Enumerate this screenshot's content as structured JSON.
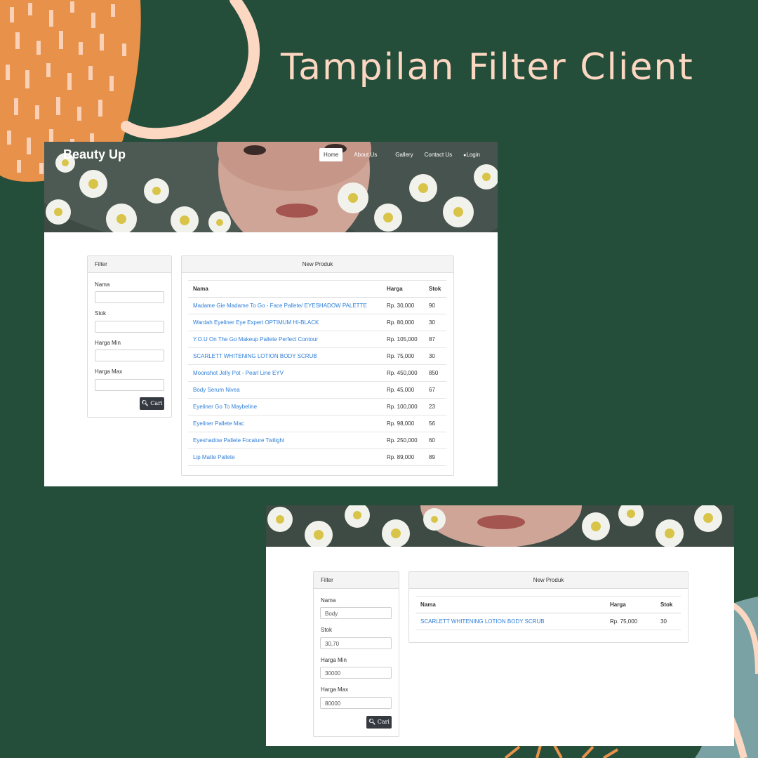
{
  "page": {
    "title": "Tampilan Filter Client"
  },
  "site": {
    "brand": "Beauty Up",
    "nav": [
      "Home",
      "About Us",
      "Gallery",
      "Contact Us",
      "Login"
    ]
  },
  "filter": {
    "header": "Filter",
    "labels": {
      "nama": "Nama",
      "stok": "Stok",
      "harga_min": "Harga Min",
      "harga_max": "Harga Max"
    },
    "button": "Cari"
  },
  "produk": {
    "header": "New Produk",
    "columns": [
      "Nama",
      "Harga",
      "Stok"
    ]
  },
  "screen1": {
    "inputs": {
      "nama": "",
      "stok": "",
      "harga_min": "",
      "harga_max": ""
    },
    "rows": [
      {
        "nama": "Madame Gie Madame To Go - Face Pallete/ EYESHADOW PALETTE",
        "harga": "Rp. 30,000",
        "stok": "90"
      },
      {
        "nama": "Wardah Eyeliner Eye Expert OPTIMUM HI-BLACK",
        "harga": "Rp. 80,000",
        "stok": "30"
      },
      {
        "nama": "Y.O.U On The Go Makeup Pallete Perfect Contour",
        "harga": "Rp. 105,000",
        "stok": "87"
      },
      {
        "nama": "SCARLETT WHITENING LOTION BODY SCRUB",
        "harga": "Rp. 75,000",
        "stok": "30"
      },
      {
        "nama": "Moonshot Jelly Pot - Pearl Line EYV",
        "harga": "Rp. 450,000",
        "stok": "850"
      },
      {
        "nama": "Body Serum Nivea",
        "harga": "Rp. 45,000",
        "stok": "67"
      },
      {
        "nama": "Eyeliner Go To Maybeline",
        "harga": "Rp. 100,000",
        "stok": "23"
      },
      {
        "nama": "Eyeliner Pallete Mac",
        "harga": "Rp. 98,000",
        "stok": "56"
      },
      {
        "nama": "Eyeshadow Pallete Focalure Twilight",
        "harga": "Rp. 250,000",
        "stok": "60"
      },
      {
        "nama": "Lip Matte Pallete",
        "harga": "Rp. 89,000",
        "stok": "89"
      }
    ]
  },
  "screen2": {
    "inputs": {
      "nama": "Body",
      "stok": "30,70",
      "harga_min": "30000",
      "harga_max": "80000"
    },
    "rows": [
      {
        "nama": "SCARLETT WHITENING LOTION BODY SCRUB",
        "harga": "Rp. 75,000",
        "stok": "30"
      }
    ]
  },
  "colors": {
    "background": "#244d3a",
    "accent_orange": "#e8914a",
    "accent_peach": "#fcd7c2",
    "link": "#2f7fd8",
    "button": "#353a40"
  },
  "icons": [
    "search-icon",
    "user-icon"
  ]
}
